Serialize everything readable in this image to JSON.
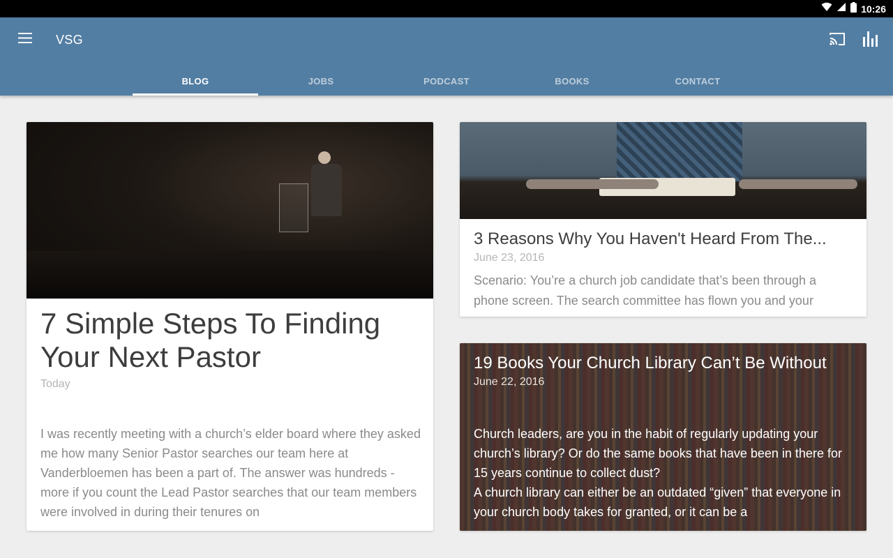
{
  "status_bar": {
    "time": "10:26",
    "icons": [
      "wifi-icon",
      "signal-icon",
      "battery-icon"
    ]
  },
  "app_bar": {
    "title": "VSG",
    "menu_icon": "menu-icon",
    "actions": [
      "cast-icon",
      "stats-icon"
    ],
    "background_color": "#537ea3"
  },
  "tabs": [
    {
      "label": "BLOG",
      "active": true
    },
    {
      "label": "JOBS",
      "active": false
    },
    {
      "label": "PODCAST",
      "active": false
    },
    {
      "label": "BOOKS",
      "active": false
    },
    {
      "label": "CONTACT",
      "active": false
    }
  ],
  "posts": [
    {
      "title": "7 Simple Steps To Finding Your Next Pastor",
      "date": "Today",
      "excerpt": "I was recently meeting with a church’s elder board where they asked me how many Senior Pastor searches our team here at Vanderbloemen has been a part of. The answer was hundreds - more if you count the Lead Pastor searches that our team members were involved in during their tenures on"
    },
    {
      "title": "3 Reasons Why You Haven't Heard From The...",
      "date": "June 23, 2016",
      "excerpt": "Scenario: You’re a church job candidate that’s been through a phone screen. The search committee has flown you and your"
    },
    {
      "title": "19 Books Your Church Library Can’t Be Without",
      "date": "June 22, 2016",
      "excerpt_1": "Church leaders, are you in the habit of regularly updating your church’s library? Or do the same books that have been in there for 15 years continue to collect dust?",
      "excerpt_2": "A church library can either be an outdated “given” that everyone in your church body takes for granted, or it can be a"
    }
  ]
}
